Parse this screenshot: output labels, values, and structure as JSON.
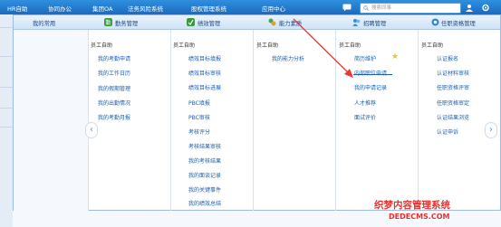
{
  "topnav": {
    "items": [
      "HR自助",
      "协同办公",
      "集团OA",
      "法务风险系统",
      "股权管理系统",
      "应用中心"
    ],
    "search_placeholder": "搜索同事",
    "colors": {
      "bar": "#1f78cc",
      "text": "#ffffff"
    }
  },
  "columns": [
    {
      "header": "我的常用",
      "icon": null,
      "groups": []
    },
    {
      "header": "勤务管理",
      "icon": "attendance-icon",
      "groups": [
        {
          "title": "员工自助",
          "items": [
            "我的考勤申请",
            "我的工作日历",
            "我的假期管理",
            "我的出勤情况",
            "我的考勤月报"
          ]
        }
      ]
    },
    {
      "header": "绩效管理",
      "icon": "performance-icon",
      "groups": [
        {
          "title": "员工自助",
          "items": [
            "绩效目标填报",
            "绩效目标审核",
            "绩效目标进展",
            "PBC填报",
            "PBC审核",
            "考核评分",
            "考核结果审核",
            "我的考核结果",
            "我的面谈记录",
            "我的关键事件",
            "我的绩效总结"
          ]
        }
      ]
    },
    {
      "header": "能力素质",
      "icon": "competency-icon",
      "groups": [
        {
          "title": "员工自助",
          "items": [
            "我的能力分析"
          ]
        }
      ]
    },
    {
      "header": "招聘管理",
      "icon": "recruit-icon",
      "groups": [
        {
          "title": "员工自助",
          "items": [
            "简历维护",
            "内部职位申请",
            "我的申请记录",
            "人才推荐",
            "面试评价"
          ]
        }
      ]
    },
    {
      "header": "任职资格管理",
      "icon": "qualification-icon",
      "groups": [
        {
          "title": "员工自助",
          "items": [
            "认证报名",
            "认证材料审核",
            "任职资格评审",
            "任职资格审定",
            "认证结果浏览",
            "认证申诉"
          ]
        }
      ]
    }
  ],
  "nav_arrows": {
    "left": "‹",
    "right": "›"
  },
  "watermark": {
    "line1": "织梦内容管理系统",
    "line2": "DEDECMS.COM"
  }
}
